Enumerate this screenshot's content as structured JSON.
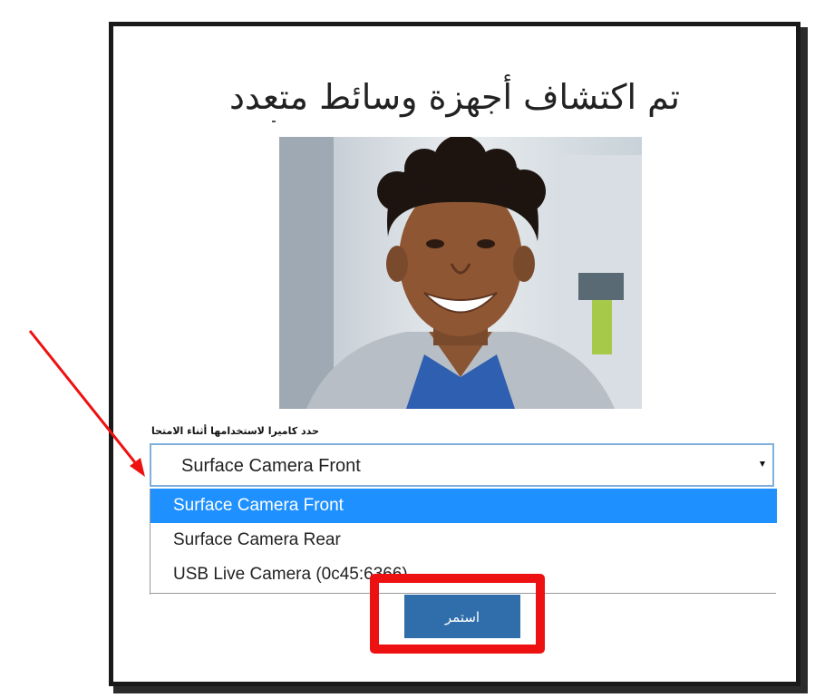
{
  "dialog": {
    "title": "تم اكتشاف أجهزة وسائط متعدد",
    "camera_label": "حدد كاميرا لاستخدامها أثناء الامتحا",
    "selected_camera": "Surface Camera Front",
    "options": [
      "Surface Camera Front",
      "Surface Camera Rear",
      "USB Live Camera (0c45:6366)"
    ],
    "continue_label": "استمر"
  },
  "icons": {
    "select_caret": "caret-down-icon",
    "annotation_arrow": "red-arrow"
  },
  "colors": {
    "highlight": "#1e90ff",
    "button": "#2f6eaa",
    "annotation": "#ee1111"
  }
}
